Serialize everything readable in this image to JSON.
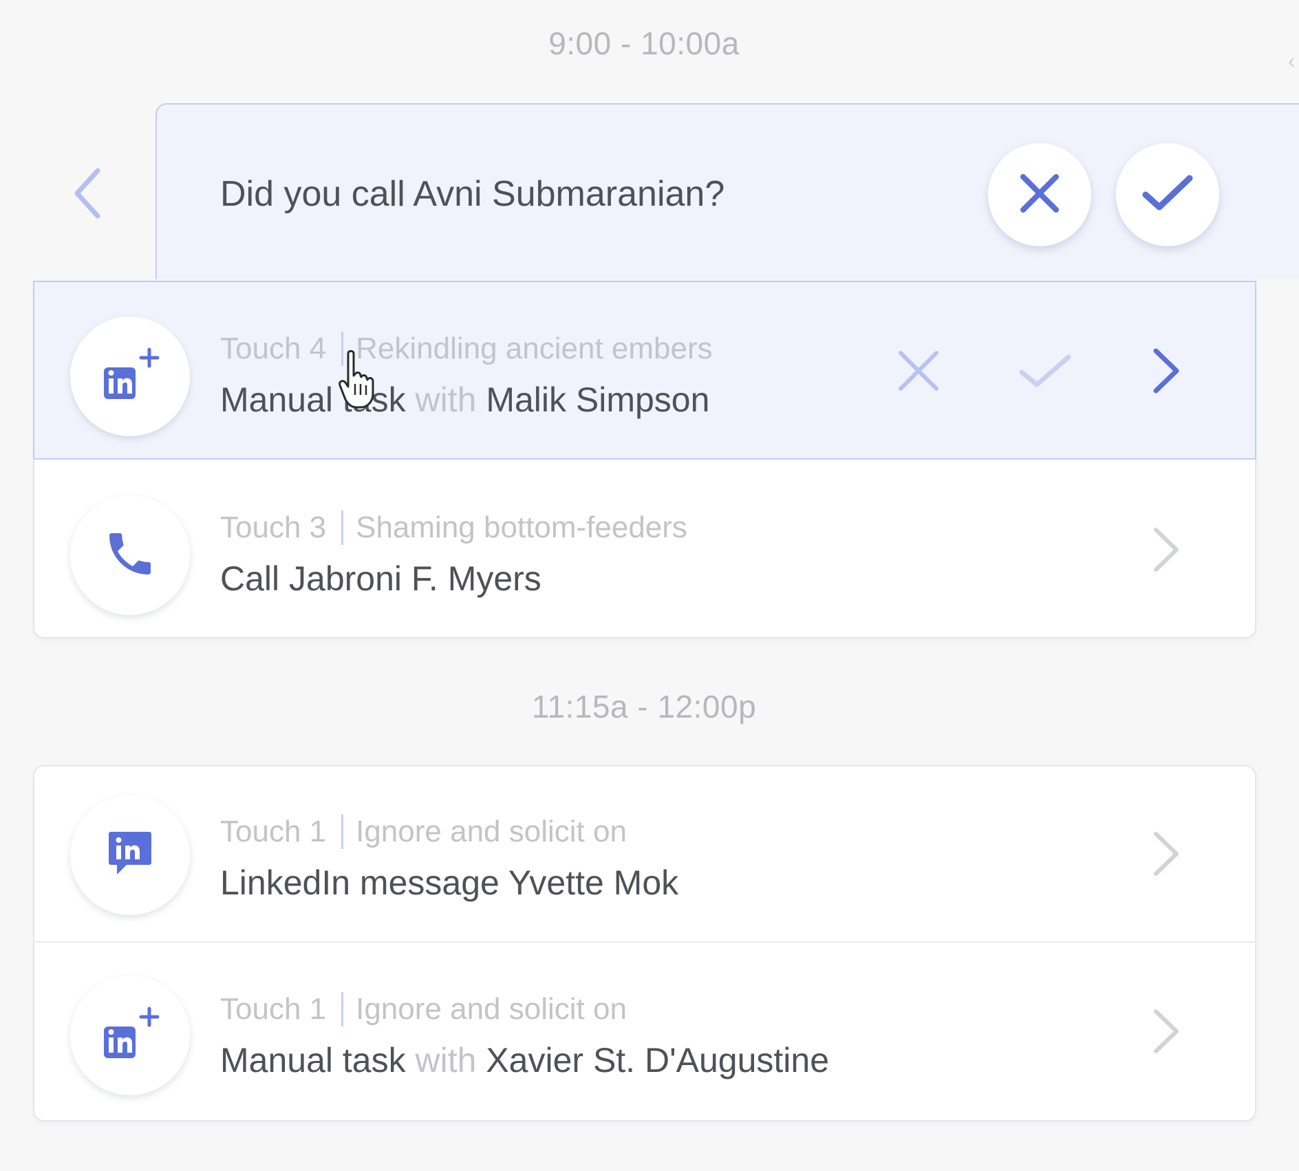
{
  "time_slots": [
    {
      "label": "9:00 - 10:00a"
    },
    {
      "label": "11:15a - 12:00p"
    }
  ],
  "prompt": {
    "question": "Did you call Avni Submaranian?",
    "back_icon": "chevron-left-icon",
    "dismiss_icon": "close-icon",
    "confirm_icon": "check-icon"
  },
  "tasks_group_1": [
    {
      "touch": "Touch 4",
      "sequence": "Rekindling ancient embers",
      "action": "Manual task",
      "connector": "with",
      "contact": "Malik Simpson",
      "icon": "linkedin-add-icon",
      "state": "hovered"
    },
    {
      "touch": "Touch 3",
      "sequence": "Shaming bottom-feeders",
      "action": "Call Jabroni F. Myers",
      "connector": "",
      "contact": "",
      "icon": "phone-icon",
      "state": "normal"
    }
  ],
  "tasks_group_2": [
    {
      "touch": "Touch 1",
      "sequence": "Ignore and solicit on",
      "action": "LinkedIn message Yvette Mok",
      "connector": "",
      "contact": "",
      "icon": "linkedin-message-icon",
      "state": "normal"
    },
    {
      "touch": "Touch 1",
      "sequence": "Ignore and solicit on",
      "action": "Manual task",
      "connector": "with",
      "contact": "Xavier St. D'Augustine",
      "icon": "linkedin-add-icon",
      "state": "normal"
    }
  ],
  "colors": {
    "accent": "#5a6fd8",
    "accent_light": "#c4cdf2",
    "active_row_bg": "#f1f3fc",
    "muted_text": "#c3c3c9",
    "primary_text": "#4f5058",
    "page_bg": "#f7f7f8"
  }
}
